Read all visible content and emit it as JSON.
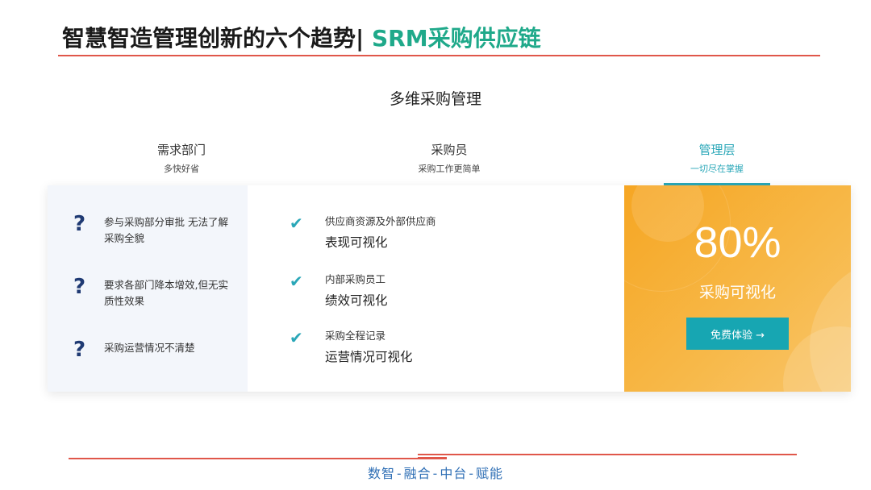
{
  "title": {
    "main": "智慧智造管理创新的六个趋势|",
    "accent": " SRM采购供应链"
  },
  "section_heading": "多维采购管理",
  "tabs": [
    {
      "label": "需求部门",
      "sub": "多快好省",
      "active": false
    },
    {
      "label": "采购员",
      "sub": "采购工作更简单",
      "active": false
    },
    {
      "label": "管理层",
      "sub": "一切尽在掌握",
      "active": true
    }
  ],
  "pain_points": [
    "参与采购部分审批 无法了解采购全貌",
    "要求各部门降本增效,但无实质性效果",
    "采购运营情况不清楚"
  ],
  "pain_icon": "?",
  "features": [
    {
      "small": "供应商资源及外部供应商",
      "big": "表现可视化"
    },
    {
      "small": "内部采购员工",
      "big": "绩效可视化"
    },
    {
      "small": "采购全程记录",
      "big": "运营情况可视化"
    }
  ],
  "check_icon": "✔",
  "highlight": {
    "percent": "80%",
    "label": "采购可视化",
    "button": "免费体验 →"
  },
  "footer": "数智-融合-中台-赋能",
  "colors": {
    "accent_green": "#1fa98a",
    "teal": "#2aa7b8",
    "orange": "#f6a623",
    "rule": "#e0574a"
  }
}
